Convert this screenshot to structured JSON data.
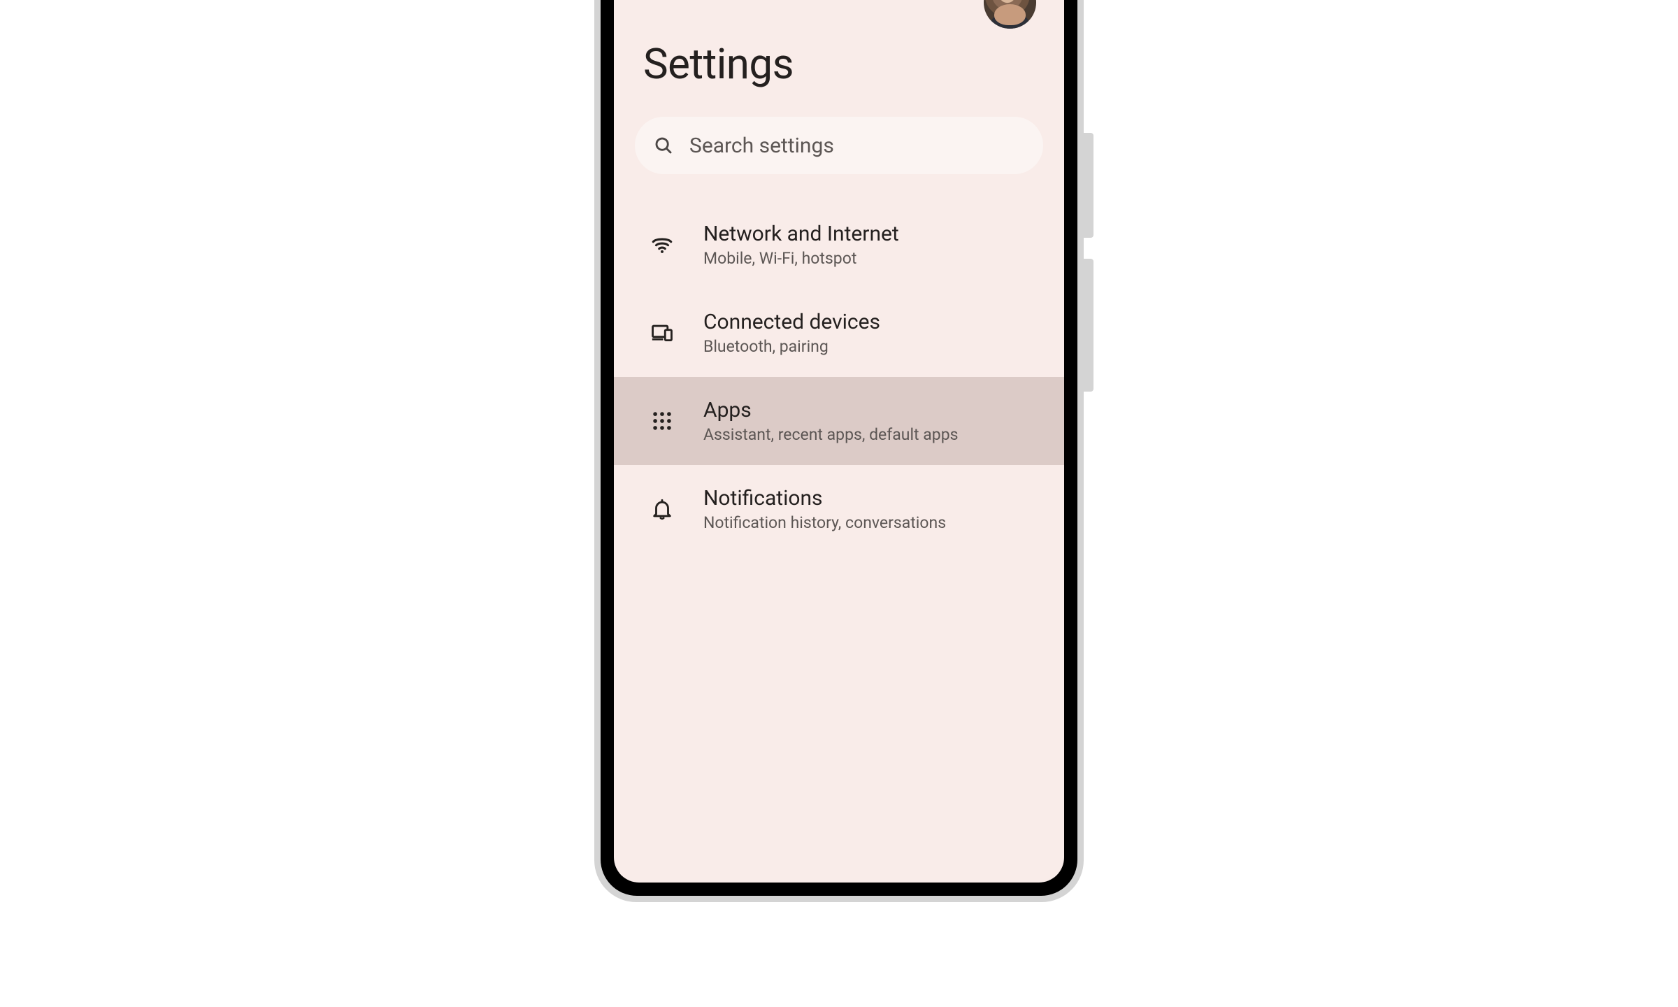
{
  "header": {
    "title": "Settings"
  },
  "search": {
    "placeholder": "Search settings"
  },
  "items": [
    {
      "icon": "wifi-icon",
      "title": "Network and Internet",
      "subtitle": "Mobile, Wi-Fi, hotspot",
      "highlighted": false
    },
    {
      "icon": "devices-icon",
      "title": "Connected devices",
      "subtitle": "Bluetooth, pairing",
      "highlighted": false
    },
    {
      "icon": "apps-grid-icon",
      "title": "Apps",
      "subtitle": "Assistant, recent apps, default apps",
      "highlighted": true
    },
    {
      "icon": "bell-icon",
      "title": "Notifications",
      "subtitle": "Notification history, conversations",
      "highlighted": false
    }
  ]
}
